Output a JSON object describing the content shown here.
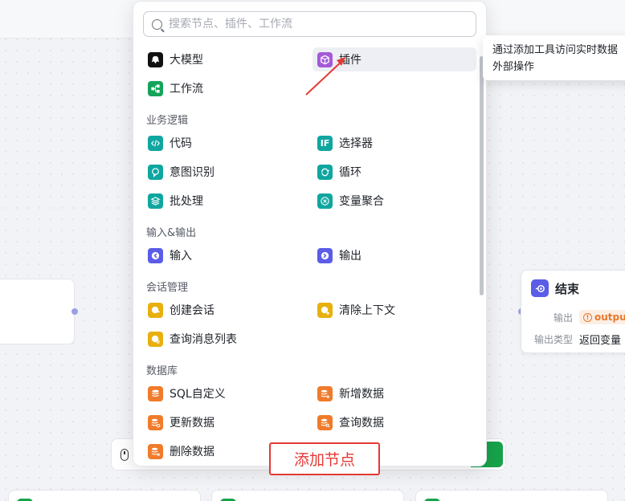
{
  "search": {
    "placeholder": "搜索节点、插件、工作流"
  },
  "top_items": [
    {
      "label": "大模型",
      "icon": "llm-icon",
      "color": "#111111"
    },
    {
      "label": "插件",
      "icon": "plugin-icon",
      "color": "#a45ad8"
    },
    {
      "label": "工作流",
      "icon": "workflow-icon",
      "color": "#15a35a"
    }
  ],
  "sections": [
    {
      "title": "业务逻辑",
      "items": [
        {
          "label": "代码",
          "icon": "code-icon",
          "color": "#0fa6a0"
        },
        {
          "label": "选择器",
          "icon": "if-icon",
          "glyph": "IF",
          "color": "#0fa6a0"
        },
        {
          "label": "意图识别",
          "icon": "intent-icon",
          "color": "#0fa6a0"
        },
        {
          "label": "循环",
          "icon": "loop-icon",
          "color": "#0fa6a0"
        },
        {
          "label": "批处理",
          "icon": "batch-icon",
          "color": "#0fa6a0"
        },
        {
          "label": "变量聚合",
          "icon": "aggregate-icon",
          "color": "#0fa6a0"
        }
      ]
    },
    {
      "title": "输入&输出",
      "items": [
        {
          "label": "输入",
          "icon": "input-icon",
          "color": "#5b5ce8"
        },
        {
          "label": "输出",
          "icon": "output-icon",
          "color": "#5b5ce8"
        }
      ]
    },
    {
      "title": "会话管理",
      "items": [
        {
          "label": "创建会话",
          "icon": "create-chat-icon",
          "color": "#e8b00f"
        },
        {
          "label": "清除上下文",
          "icon": "clear-context-icon",
          "color": "#e8b00f"
        },
        {
          "label": "查询消息列表",
          "icon": "query-messages-icon",
          "color": "#e8b00f"
        }
      ]
    },
    {
      "title": "数据库",
      "items": [
        {
          "label": "SQL自定义",
          "icon": "sql-icon",
          "color": "#f07b2a"
        },
        {
          "label": "新增数据",
          "icon": "db-add-icon",
          "color": "#f07b2a"
        },
        {
          "label": "更新数据",
          "icon": "db-update-icon",
          "color": "#f07b2a"
        },
        {
          "label": "查询数据",
          "icon": "db-query-icon",
          "color": "#f07b2a"
        },
        {
          "label": "删除数据",
          "icon": "db-delete-icon",
          "color": "#f07b2a"
        }
      ]
    }
  ],
  "tooltip": {
    "line1": "通过添加工具访问实时数据",
    "line2": "外部操作"
  },
  "end_node": {
    "title": "结束",
    "output_label": "输出",
    "output_value": "output",
    "output_type_label": "输出类型",
    "output_type_value": "返回变量"
  },
  "annotation": {
    "label": "添加节点",
    "color": "#e53935"
  }
}
